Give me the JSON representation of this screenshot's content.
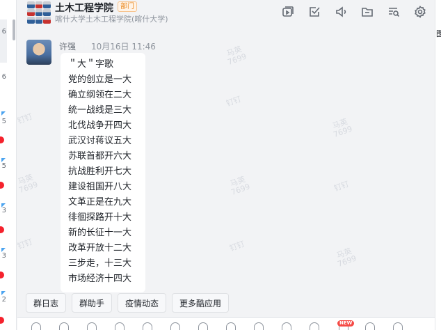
{
  "left_strip": {
    "counts": [
      "6",
      "6",
      "5",
      "5",
      "3",
      "3",
      "2"
    ],
    "accent_color": "#4aa3f0",
    "dot_color": "#f5222d"
  },
  "header": {
    "title": "土木工程学院",
    "tag": "部门",
    "subtitle": "喀什大学土木工程学院(喀什大学)",
    "toolbar": [
      {
        "name": "video-icon"
      },
      {
        "name": "task-icon"
      },
      {
        "name": "announcement-icon"
      },
      {
        "name": "folder-icon"
      },
      {
        "name": "search-history-icon"
      },
      {
        "name": "settings-icon"
      }
    ]
  },
  "message": {
    "sender": "许强",
    "time": "10月16日 11:46",
    "lines": [
      "＂大＂字歌",
      "党的创立是一大",
      "确立纲领在二大",
      "统一战线是三大",
      "北伐战争开四大",
      "武汉讨蒋议五大",
      "苏联首都开六大",
      "抗战胜利开七大",
      "建设祖国开八大",
      "文革正是在九大",
      "徘徊探路开十大",
      "新的长征十一大",
      "改革开放十二大",
      "三步走，十三大",
      "市场经济十四大"
    ]
  },
  "watermark": {
    "name": "马英",
    "number": "7699",
    "alt": "钉钉"
  },
  "quick_actions": [
    "群日志",
    "群助手",
    "疫情动态",
    "更多酷应用"
  ],
  "input_bar": {
    "new_badge": "NEW"
  },
  "right_edge": {
    "text": "图"
  },
  "colors": {
    "background": "#f2f3f5",
    "bubble": "#ffffff",
    "tag_orange": "#e8851a"
  }
}
